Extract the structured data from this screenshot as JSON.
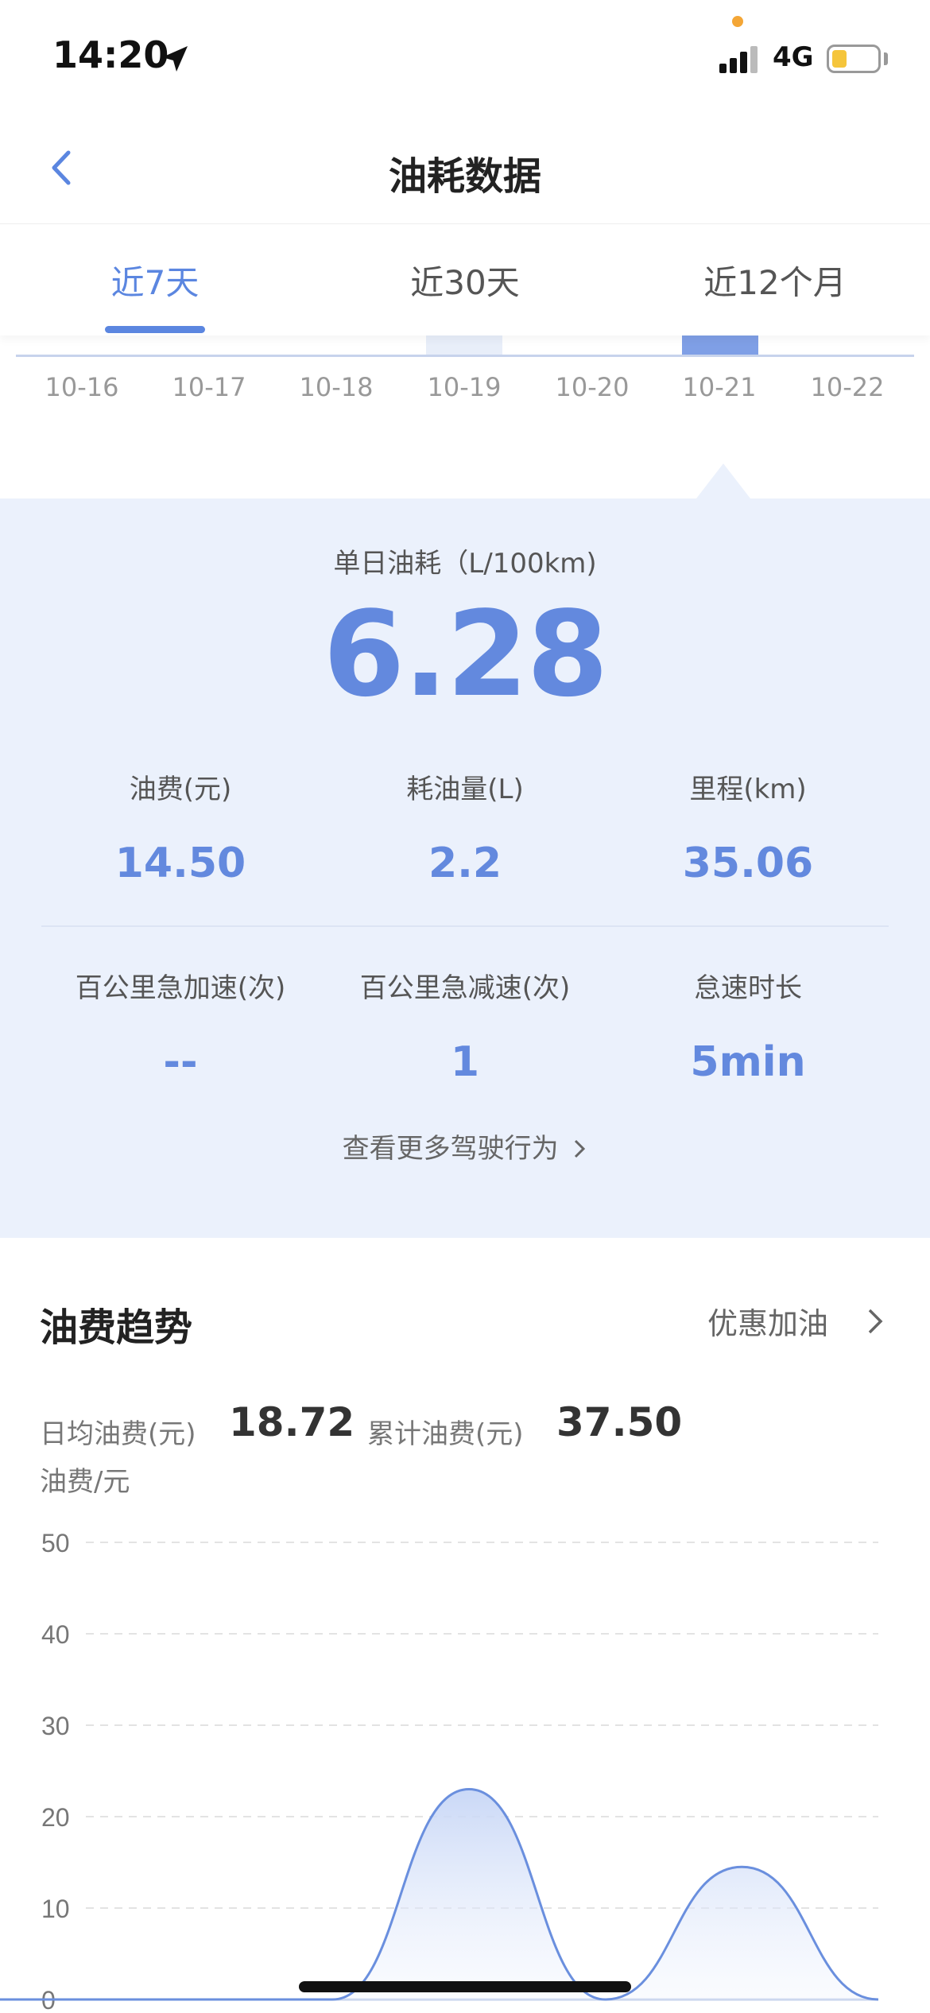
{
  "status_bar": {
    "time": "14:20",
    "network": "4G"
  },
  "nav": {
    "title": "油耗数据"
  },
  "tabs": [
    "近7天",
    "近30天",
    "近12个月"
  ],
  "tab_active_index": 0,
  "top_chart": {
    "dates": [
      "10-16",
      "10-17",
      "10-18",
      "10-19",
      "10-20",
      "10-21",
      "10-22"
    ],
    "selected_date": "10-21"
  },
  "detail": {
    "daily_label": "单日油耗（L/100km)",
    "daily_value": "6.28",
    "metrics_row1": [
      {
        "label": "油费(元)",
        "value": "14.50"
      },
      {
        "label": "耗油量(L)",
        "value": "2.2"
      },
      {
        "label": "里程(km)",
        "value": "35.06"
      }
    ],
    "metrics_row2": [
      {
        "label": "百公里急加速(次)",
        "value": "--"
      },
      {
        "label": "百公里急减速(次)",
        "value": "1"
      },
      {
        "label": "怠速时长",
        "value": "5min"
      }
    ],
    "more_link": "查看更多驾驶行为"
  },
  "trend": {
    "title": "油费趋势",
    "refuel_link": "优惠加油",
    "avg_label": "日均油费(元)",
    "avg_value": "18.72",
    "total_label": "累计油费(元)",
    "total_value": "37.50",
    "unit_label": "油费/元"
  },
  "colors": {
    "accent": "#5b86e0",
    "panel_bg": "#ebf1fc"
  },
  "chart_data": {
    "type": "area",
    "x": [
      "10-16",
      "10-17",
      "10-18",
      "10-19",
      "10-20",
      "10-21",
      "10-22"
    ],
    "series": [
      {
        "values": [
          0,
          0,
          0,
          23,
          0,
          14.5,
          0
        ]
      }
    ],
    "ylim": [
      0,
      50
    ],
    "yticks": [
      0,
      10,
      20,
      30,
      40,
      50
    ],
    "grid": true,
    "xlabel": "",
    "ylabel": "油费/元"
  }
}
